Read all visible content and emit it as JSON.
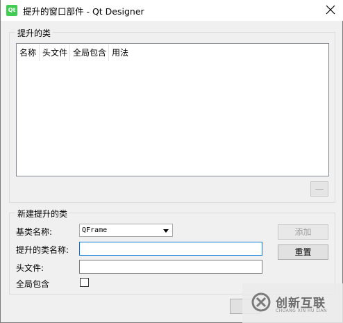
{
  "window": {
    "title": "提升的窗口部件 - Qt Designer",
    "app_icon_text": "Qt"
  },
  "promoted_group": {
    "title": "提升的类",
    "table": {
      "columns": [
        "名称",
        "头文件",
        "全局包含",
        "用法"
      ],
      "rows": []
    }
  },
  "new_group": {
    "title": "新建提升的类",
    "base_class_label": "基类名称:",
    "base_class_value": "QFrame",
    "class_name_label": "提升的类名称:",
    "class_name_value": "",
    "header_label": "头文件:",
    "header_value": "",
    "global_include_label": "全局包含",
    "global_include_checked": false,
    "add_button": "添加",
    "reset_button": "重置"
  },
  "watermark": {
    "brand": "创新互联",
    "subtitle": "CHUANG XIN HU LIAN"
  }
}
